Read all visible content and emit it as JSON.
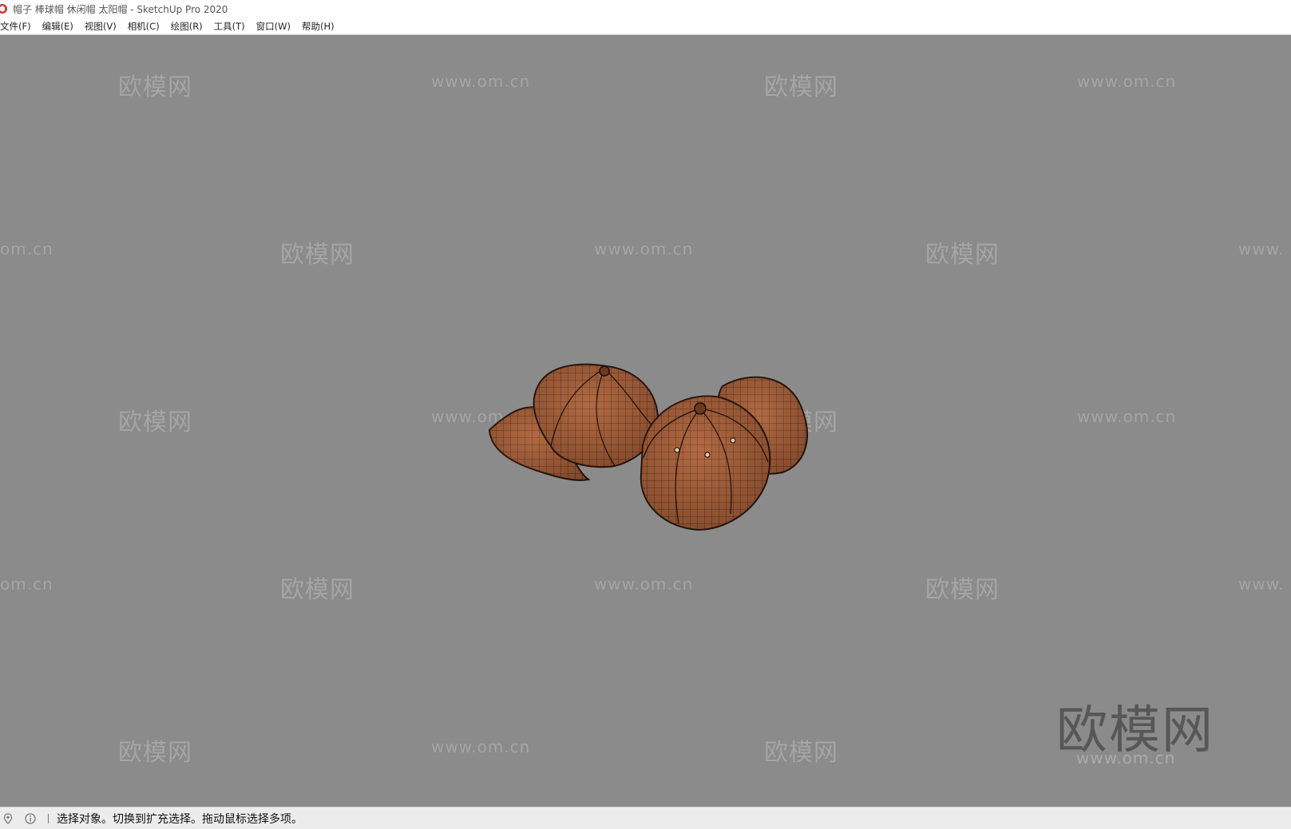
{
  "window": {
    "title": "帽子 棒球帽 休闲帽 太阳帽 - SketchUp Pro 2020",
    "app_icon": "sketchup-logo-icon",
    "accent_color": "#d9342b"
  },
  "menu": {
    "items": [
      "文件(F)",
      "编辑(E)",
      "视图(V)",
      "相机(C)",
      "绘图(R)",
      "工具(T)",
      "窗口(W)",
      "帮助(H)"
    ]
  },
  "viewport": {
    "background": "#8b8b8b",
    "model_color": "#a8623c",
    "model_description_visible": "two baseball caps wireframe mesh"
  },
  "watermarks": {
    "brand": "欧模网",
    "url": "www.om.cn",
    "url_partial_left": "om.cn",
    "url_partial_right": "www."
  },
  "statusbar": {
    "icons": [
      "geolocation-icon",
      "info-icon"
    ],
    "message": "选择对象。切换到扩充选择。拖动鼠标选择多项。"
  }
}
